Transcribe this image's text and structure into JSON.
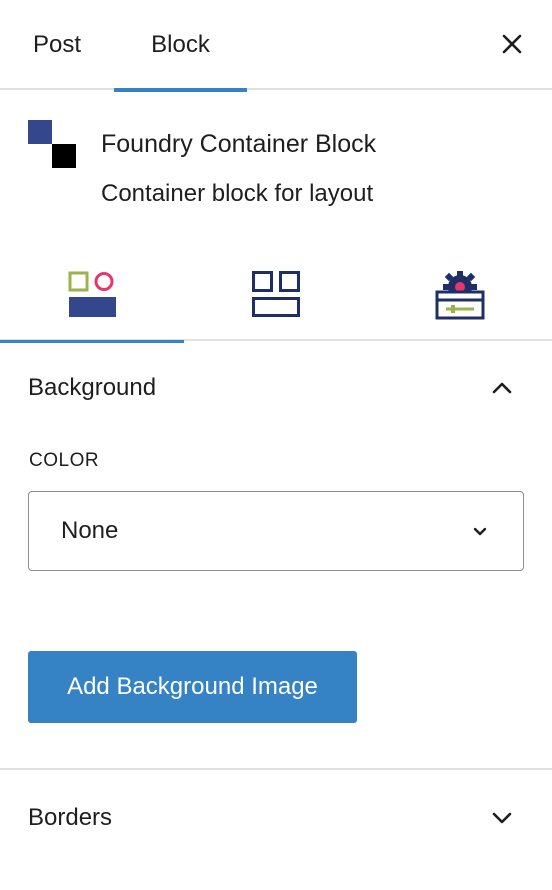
{
  "tabs": {
    "post": "Post",
    "block": "Block"
  },
  "block": {
    "title": "Foundry Container Block",
    "description": "Container block for layout"
  },
  "icon_tabs": [
    {
      "icon": "style-icon",
      "active": true
    },
    {
      "icon": "layout-grid-icon",
      "active": false
    },
    {
      "icon": "advanced-settings-icon",
      "active": false
    }
  ],
  "background": {
    "title": "Background",
    "expanded": true,
    "color_label": "COLOR",
    "color_value": "None",
    "add_image_label": "Add Background Image"
  },
  "borders": {
    "title": "Borders",
    "expanded": false
  },
  "colors": {
    "accent": "#3582c4",
    "brand_navy": "#34468c",
    "brand_green": "#9eb14a",
    "brand_pink": "#e5366d"
  }
}
